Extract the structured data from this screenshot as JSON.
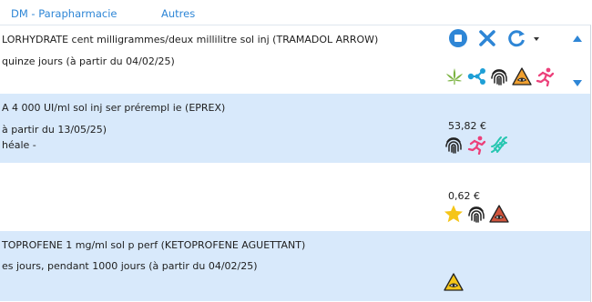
{
  "tabs": [
    {
      "label": "DM - Parapharmacie"
    },
    {
      "label": "Autres"
    }
  ],
  "rows": [
    {
      "line1": "LORHYDRATE cent milligrammes/deux millilitre sol inj (TRAMADOL ARROW)",
      "line2": "quinze jours (à partir du 04/02/25)",
      "icons": [
        "cannabis-leaf-icon",
        "molecule-icon",
        "fingerprint-icon",
        "drowsiness-warning-icon",
        "doping-runner-icon"
      ]
    },
    {
      "line1": "A 4 000 UI/ml sol inj ser prérempl ie (EPREX)",
      "line2": "à partir du 13/05/25)",
      "line3": "héale -",
      "price": "53,82 €",
      "icons": [
        "fingerprint-icon",
        "doping-runner-icon",
        "dna-icon"
      ]
    },
    {
      "price": "0,62 €",
      "icons": [
        "star-icon",
        "fingerprint-icon",
        "drowsiness-warning-icon"
      ]
    },
    {
      "line1": "TOPROFENE 1 mg/ml sol p perf (KETOPROFENE AGUETTANT)",
      "line2": "es jours, pendant 1000 jours (à partir du 04/02/25)",
      "icons": [
        "drowsiness-warning-icon"
      ]
    }
  ],
  "colors": {
    "accent": "#2e86d6",
    "row_blue": "#d8e9fb",
    "cannabis": "#7cb342",
    "molecule": "#1e9fd6",
    "doping": "#ec407a",
    "dna": "#26c6b0",
    "warning_orange": "#f0a030",
    "warning_red": "#d0543c",
    "warning_yellow": "#f5c518",
    "star": "#f5c518"
  }
}
